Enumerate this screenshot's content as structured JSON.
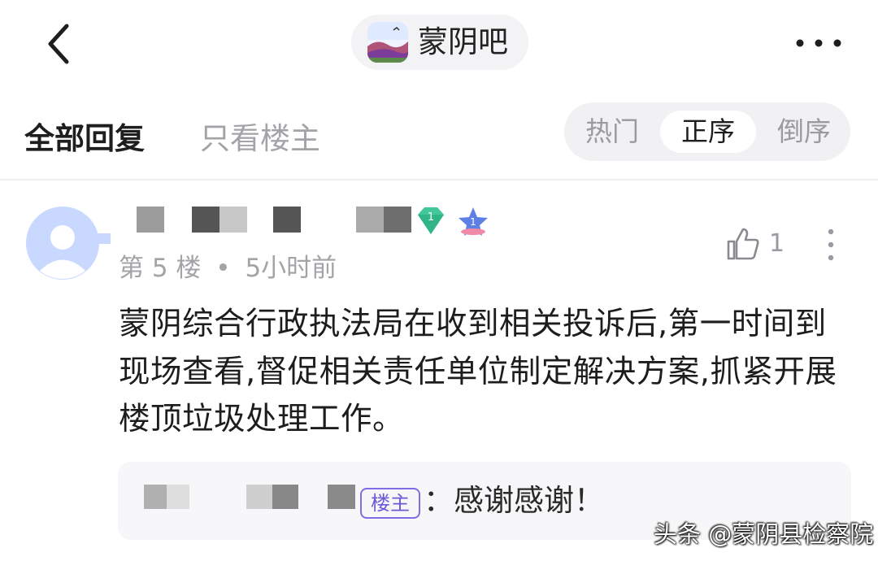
{
  "header": {
    "forum_name": "蒙阴吧",
    "back_icon": "chevron-left-icon",
    "more_icon": "more-horizontal-icon"
  },
  "tabs": {
    "all_replies": "全部回复",
    "only_op": "只看楼主"
  },
  "sort": {
    "options": [
      "热门",
      "正序",
      "倒序"
    ],
    "selected": "正序"
  },
  "post": {
    "level_badge": "1",
    "rank_badge": "1",
    "floor": "第 5 楼",
    "separator": "•",
    "time": "5小时前",
    "likes": "1",
    "content": "蒙阴综合行政执法局在收到相关投诉后,第一时间到现场查看,督促相关责任单位制定解决方案,抓紧开展楼顶垃圾处理工作。",
    "reply": {
      "tag": "楼主",
      "text": "：感谢感谢！"
    }
  },
  "watermark": "头条 @蒙阴县检察院",
  "colors": {
    "accent_purple": "#7e6ee3",
    "avatar_blue": "#c9d8ff",
    "gem_green": "#41c79a",
    "muted_text": "#a3a3a8"
  }
}
